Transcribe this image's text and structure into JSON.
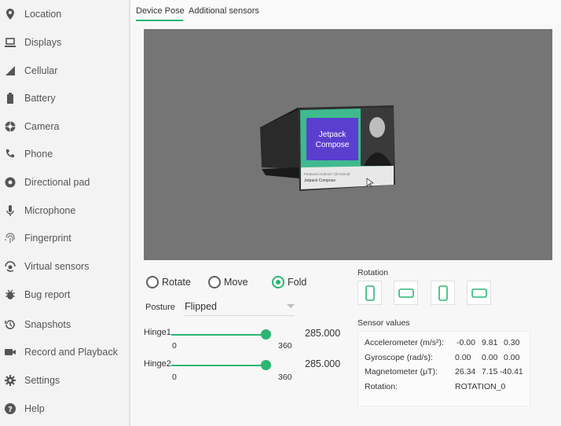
{
  "sidebar": {
    "items": [
      {
        "label": "Location",
        "icon": "location-pin-icon"
      },
      {
        "label": "Displays",
        "icon": "laptop-icon"
      },
      {
        "label": "Cellular",
        "icon": "signal-icon"
      },
      {
        "label": "Battery",
        "icon": "battery-icon"
      },
      {
        "label": "Camera",
        "icon": "camera-aperture-icon"
      },
      {
        "label": "Phone",
        "icon": "phone-icon"
      },
      {
        "label": "Directional pad",
        "icon": "dpad-icon"
      },
      {
        "label": "Microphone",
        "icon": "microphone-icon"
      },
      {
        "label": "Fingerprint",
        "icon": "fingerprint-icon"
      },
      {
        "label": "Virtual sensors",
        "icon": "rotate-device-icon"
      },
      {
        "label": "Bug report",
        "icon": "bug-icon"
      },
      {
        "label": "Snapshots",
        "icon": "history-icon"
      },
      {
        "label": "Record and Playback",
        "icon": "video-camera-icon"
      },
      {
        "label": "Settings",
        "icon": "gear-icon"
      },
      {
        "label": "Help",
        "icon": "help-icon"
      }
    ]
  },
  "tabs": {
    "device_pose": "Device Pose",
    "additional_sensors": "Additional sensors"
  },
  "preview": {
    "card_text": "Jetpack Compose",
    "caption_line1": "Featured Android / @Android",
    "caption_line2": "Jetpack Compose"
  },
  "mode": {
    "rotate": "Rotate",
    "move": "Move",
    "fold": "Fold",
    "selected": "Fold"
  },
  "posture": {
    "label": "Posture",
    "value": "Flipped"
  },
  "hinges": [
    {
      "label": "Hinge1",
      "min": "0",
      "max": "360",
      "value": "285.000",
      "fraction": 0.79
    },
    {
      "label": "Hinge2",
      "min": "0",
      "max": "360",
      "value": "285.000",
      "fraction": 0.79
    }
  ],
  "rotation": {
    "title": "Rotation",
    "buttons": [
      "portrait-icon",
      "landscape-icon",
      "reverse-portrait-icon",
      "reverse-landscape-icon"
    ]
  },
  "sensors": {
    "title": "Sensor values",
    "rows": [
      {
        "name": "Accelerometer (m/s²):",
        "values": [
          "-0.00",
          "9.81",
          "0.30"
        ]
      },
      {
        "name": "Gyroscope (rad/s):",
        "values": [
          "0.00",
          "0.00",
          "0.00"
        ]
      },
      {
        "name": "Magnetometer (μT):",
        "values": [
          "26.34",
          "7.15",
          "-40.41"
        ]
      },
      {
        "name": "Rotation:",
        "values": [
          "ROTATION_0"
        ]
      }
    ]
  },
  "colors": {
    "accent": "#2bb673",
    "viewport": "#757575"
  }
}
